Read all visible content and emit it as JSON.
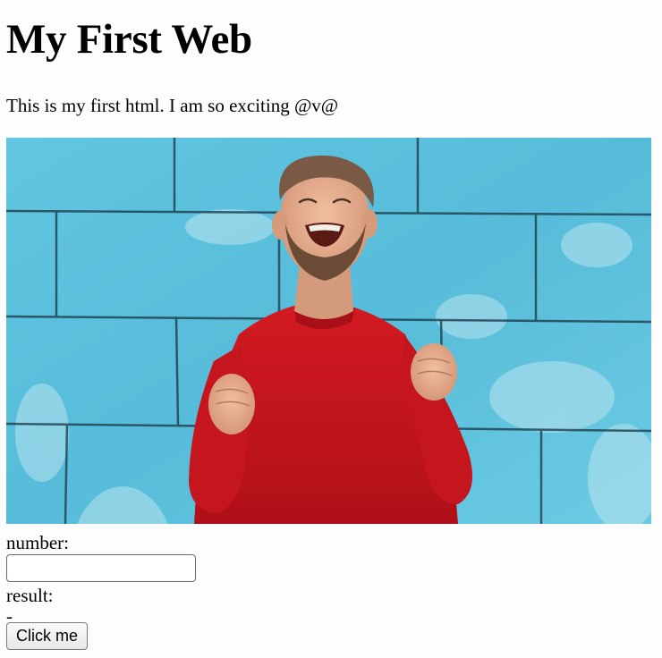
{
  "page": {
    "heading": "My First Web",
    "intro_text": "This is my first html. I am so exciting @v@"
  },
  "hero_image": {
    "subject": "laughing man in red sweater with raised fists in front of blue brick wall",
    "colors": {
      "wall": "#5cc3e0",
      "mortar": "#1a3440",
      "sweater": "#c8141c",
      "skin": "#e2a98a",
      "hair": "#7a5a44"
    }
  },
  "form": {
    "number_label": "number:",
    "number_value": "",
    "result_label": "result:",
    "result_value": "-",
    "button_label": "Click me"
  }
}
